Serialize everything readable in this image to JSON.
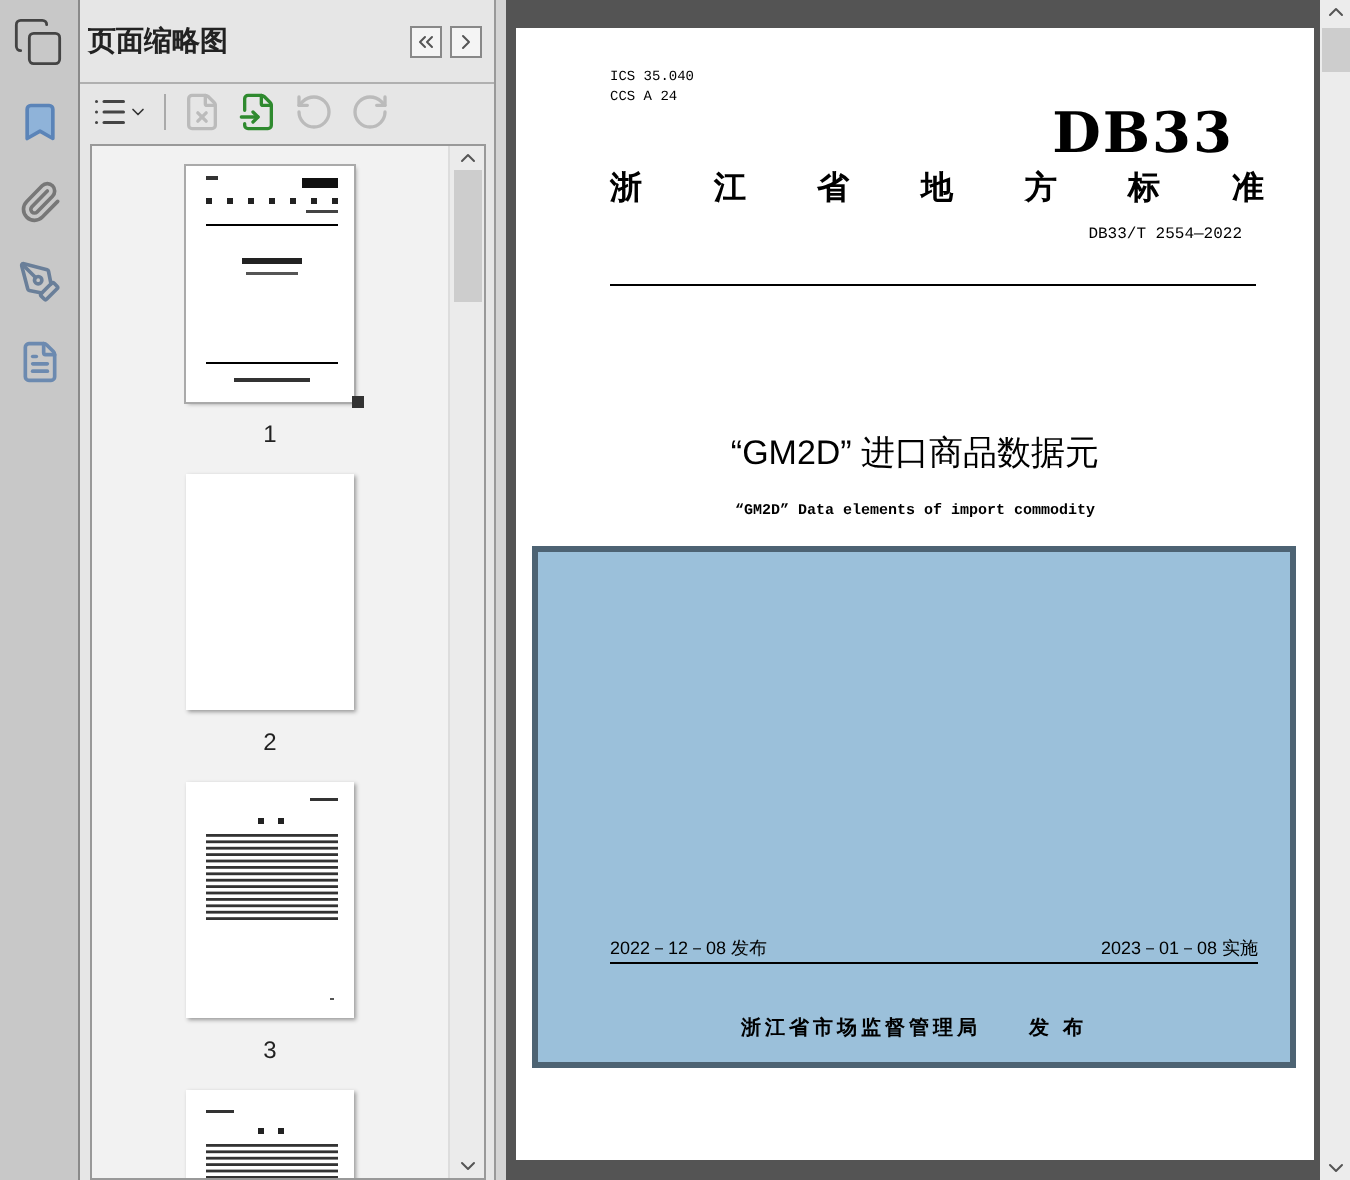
{
  "panel": {
    "title": "页面缩略图"
  },
  "thumbnails": [
    {
      "kind": "cover",
      "label": "1",
      "selected": true
    },
    {
      "kind": "blank",
      "label": "2",
      "selected": false
    },
    {
      "kind": "toc",
      "label": "3",
      "selected": false
    },
    {
      "kind": "text",
      "selected": false
    }
  ],
  "document": {
    "codes": [
      "ICS 35.040",
      "CCS A 24"
    ],
    "logo": "DB33",
    "heading": [
      "浙",
      "江",
      "省",
      "地",
      "方",
      "标",
      "准"
    ],
    "number": "DB33/T 2554—2022",
    "title": "“GM2D” 进口商品数据元",
    "subtitle": "“GM2D” Data elements of import commodity",
    "selection": {
      "on": true
    },
    "issue_date": "2022－12－08 发布",
    "effective_date": "2023－01－08 实施",
    "issuer": "浙江省市场监督管理局",
    "issuer_action": "发 布"
  }
}
